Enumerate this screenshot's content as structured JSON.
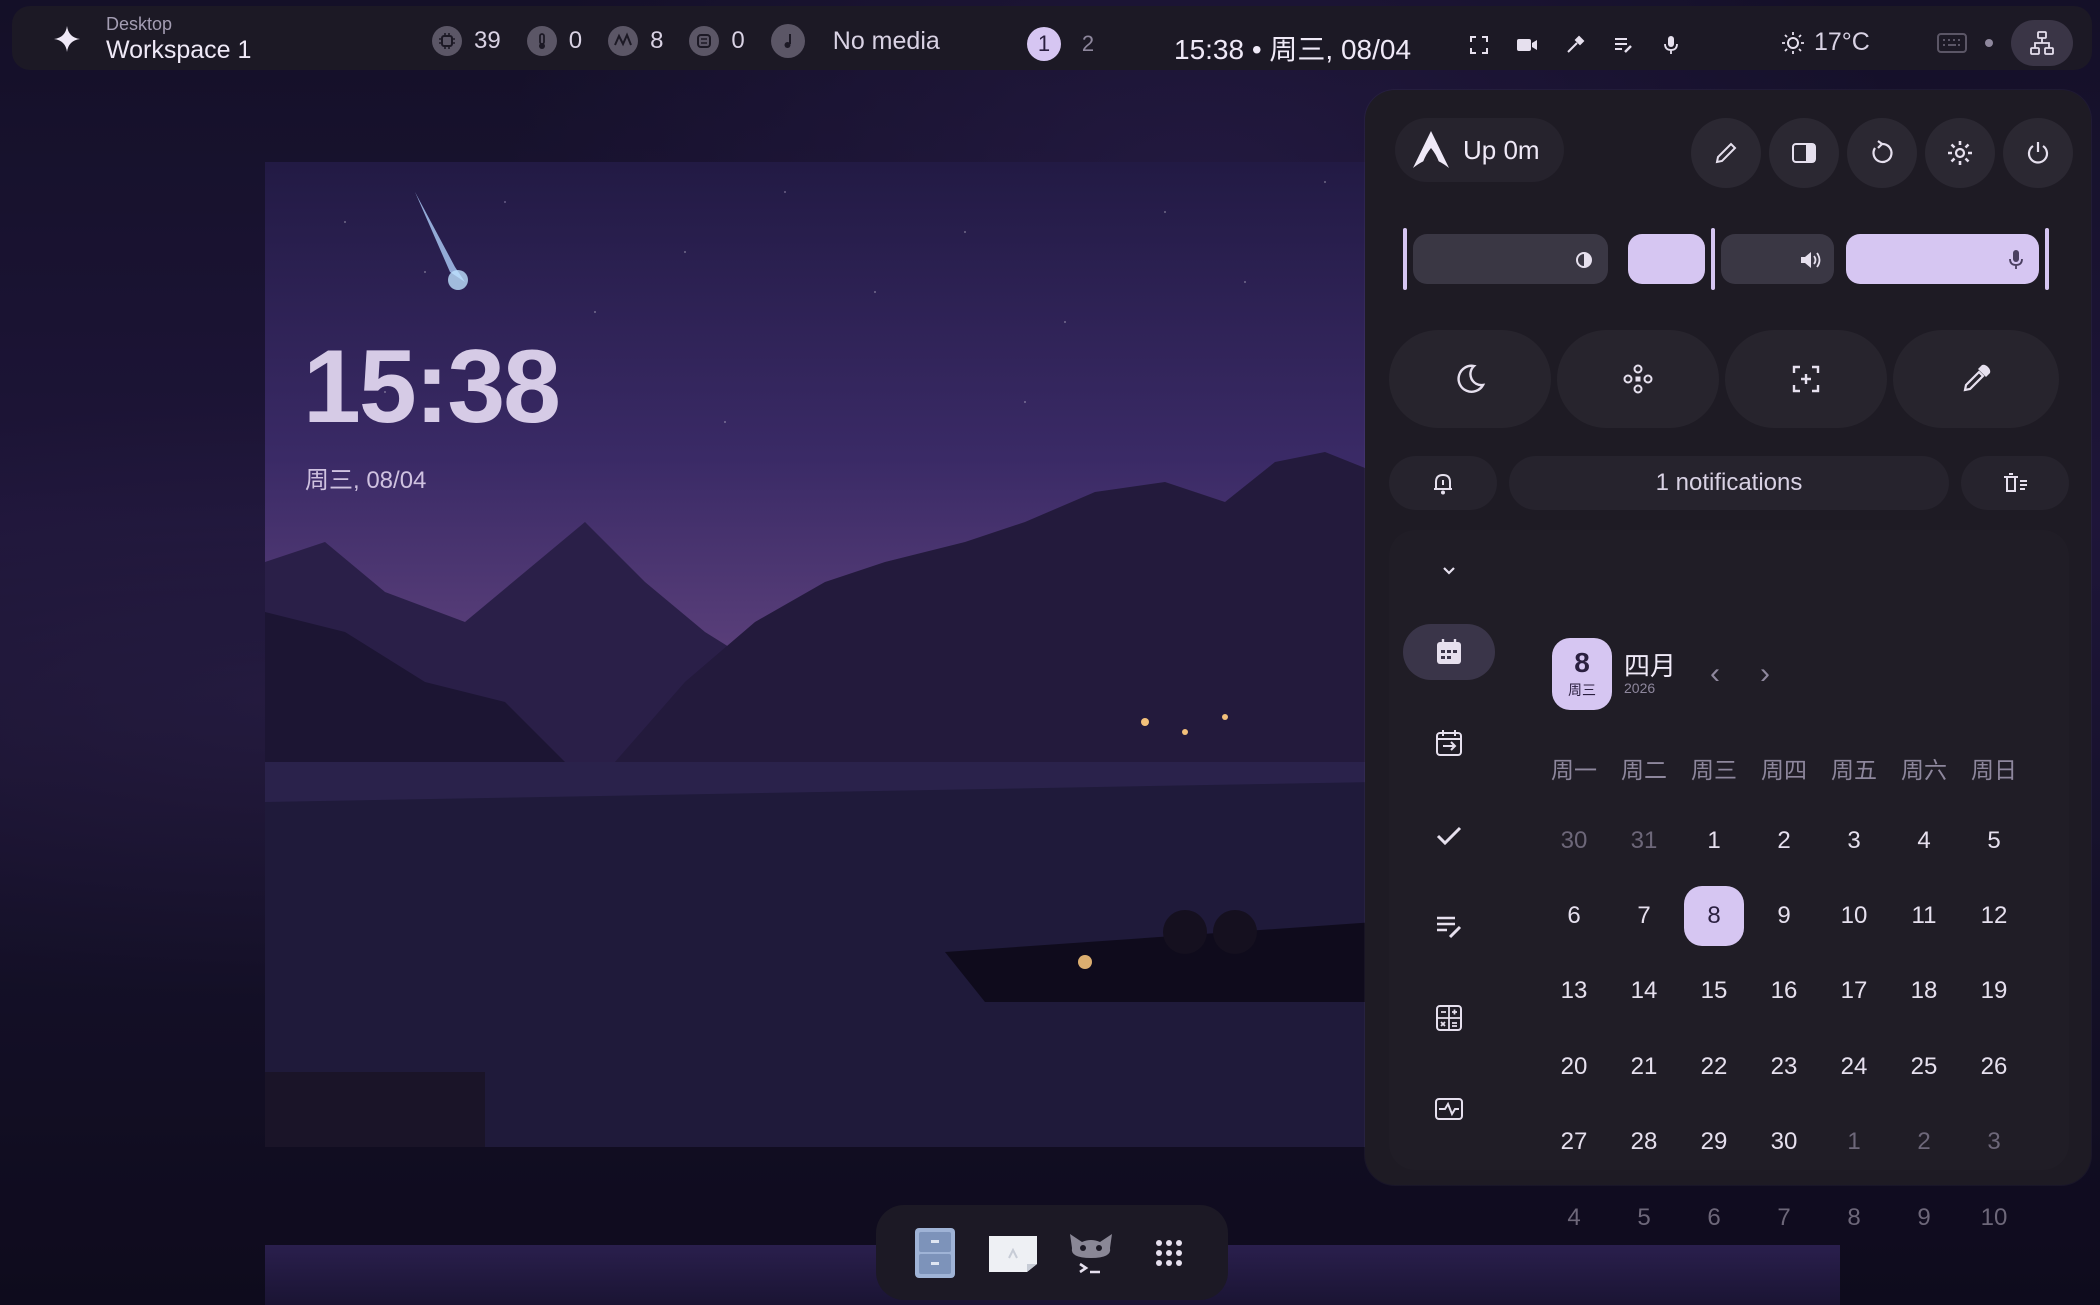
{
  "topbar": {
    "workspace_subtitle": "Desktop",
    "workspace_title": "Workspace 1",
    "stats": [
      {
        "icon": "cpu-icon",
        "value": "39"
      },
      {
        "icon": "thermometer-icon",
        "value": "0"
      },
      {
        "icon": "memory-icon",
        "value": "8"
      },
      {
        "icon": "disk-icon",
        "value": "0"
      }
    ],
    "media_label": "No media",
    "workspaces": [
      "1",
      "2"
    ],
    "active_workspace": "1",
    "clock": "15:38 • 周三, 08/04",
    "weather": "17°C"
  },
  "desktop": {
    "clock": "15:38",
    "date": "周三, 08/04"
  },
  "panel": {
    "uptime": "Up 0m",
    "notifications_label": "1 notifications",
    "calendar": {
      "day_number": "8",
      "day_of_week": "周三",
      "month": "四月",
      "year": "2026",
      "weekdays": [
        "周一",
        "周二",
        "周三",
        "周四",
        "周五",
        "周六",
        "周日"
      ],
      "weeks": [
        [
          {
            "d": "30",
            "o": true
          },
          {
            "d": "31",
            "o": true
          },
          {
            "d": "1"
          },
          {
            "d": "2"
          },
          {
            "d": "3"
          },
          {
            "d": "4"
          },
          {
            "d": "5"
          }
        ],
        [
          {
            "d": "6"
          },
          {
            "d": "7"
          },
          {
            "d": "8",
            "today": true
          },
          {
            "d": "9"
          },
          {
            "d": "10"
          },
          {
            "d": "11"
          },
          {
            "d": "12"
          }
        ],
        [
          {
            "d": "13"
          },
          {
            "d": "14"
          },
          {
            "d": "15"
          },
          {
            "d": "16"
          },
          {
            "d": "17"
          },
          {
            "d": "18"
          },
          {
            "d": "19"
          }
        ],
        [
          {
            "d": "20"
          },
          {
            "d": "21"
          },
          {
            "d": "22"
          },
          {
            "d": "23"
          },
          {
            "d": "24"
          },
          {
            "d": "25"
          },
          {
            "d": "26"
          }
        ],
        [
          {
            "d": "27"
          },
          {
            "d": "28"
          },
          {
            "d": "29"
          },
          {
            "d": "30"
          },
          {
            "d": "1",
            "o": true
          },
          {
            "d": "2",
            "o": true
          },
          {
            "d": "3",
            "o": true
          }
        ],
        [
          {
            "d": "4",
            "o": true
          },
          {
            "d": "5",
            "o": true
          },
          {
            "d": "6",
            "o": true
          },
          {
            "d": "7",
            "o": true
          },
          {
            "d": "8",
            "o": true
          },
          {
            "d": "9",
            "o": true
          },
          {
            "d": "10",
            "o": true
          }
        ]
      ]
    },
    "brightness_level": 0.0,
    "volume_level": 0.0,
    "mic_level": 1.0
  },
  "colors": {
    "accent": "#d6c6f2",
    "panel_bg": "#1e1b24",
    "bar_bg": "#1c1925"
  }
}
